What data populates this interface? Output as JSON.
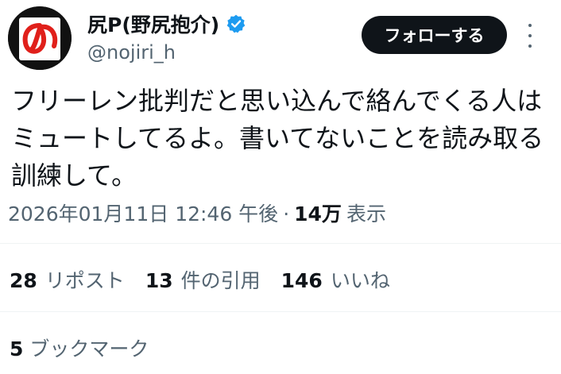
{
  "user": {
    "display_name": "尻P(野尻抱介)",
    "handle": "@nojiri_h",
    "avatar_glyph": "の",
    "verified_icon": "verified-badge-icon",
    "verified_color": "#1d9bf0"
  },
  "header": {
    "follow_label": "フォローする",
    "more_icon": "more-options-icon"
  },
  "tweet": {
    "text": "フリーレン批判だと思い込んで絡んでくる人はミュートしてるよ。書いてないことを読み取る訓練して。"
  },
  "meta": {
    "timestamp": "2026年01月11日 12:46 午後",
    "separator": "·",
    "views_count": "14万",
    "views_label": "表示"
  },
  "stats": {
    "reposts_count": "28",
    "reposts_label": "リポスト",
    "quotes_count": "13",
    "quotes_label": "件の引用",
    "likes_count": "146",
    "likes_label": "いいね",
    "bookmarks_count": "5",
    "bookmarks_label": "ブックマーク"
  },
  "colors": {
    "primary_text": "#0f1419",
    "secondary_text": "#536471",
    "button_bg": "#0f1419",
    "avatar_accent": "#e0201b"
  }
}
